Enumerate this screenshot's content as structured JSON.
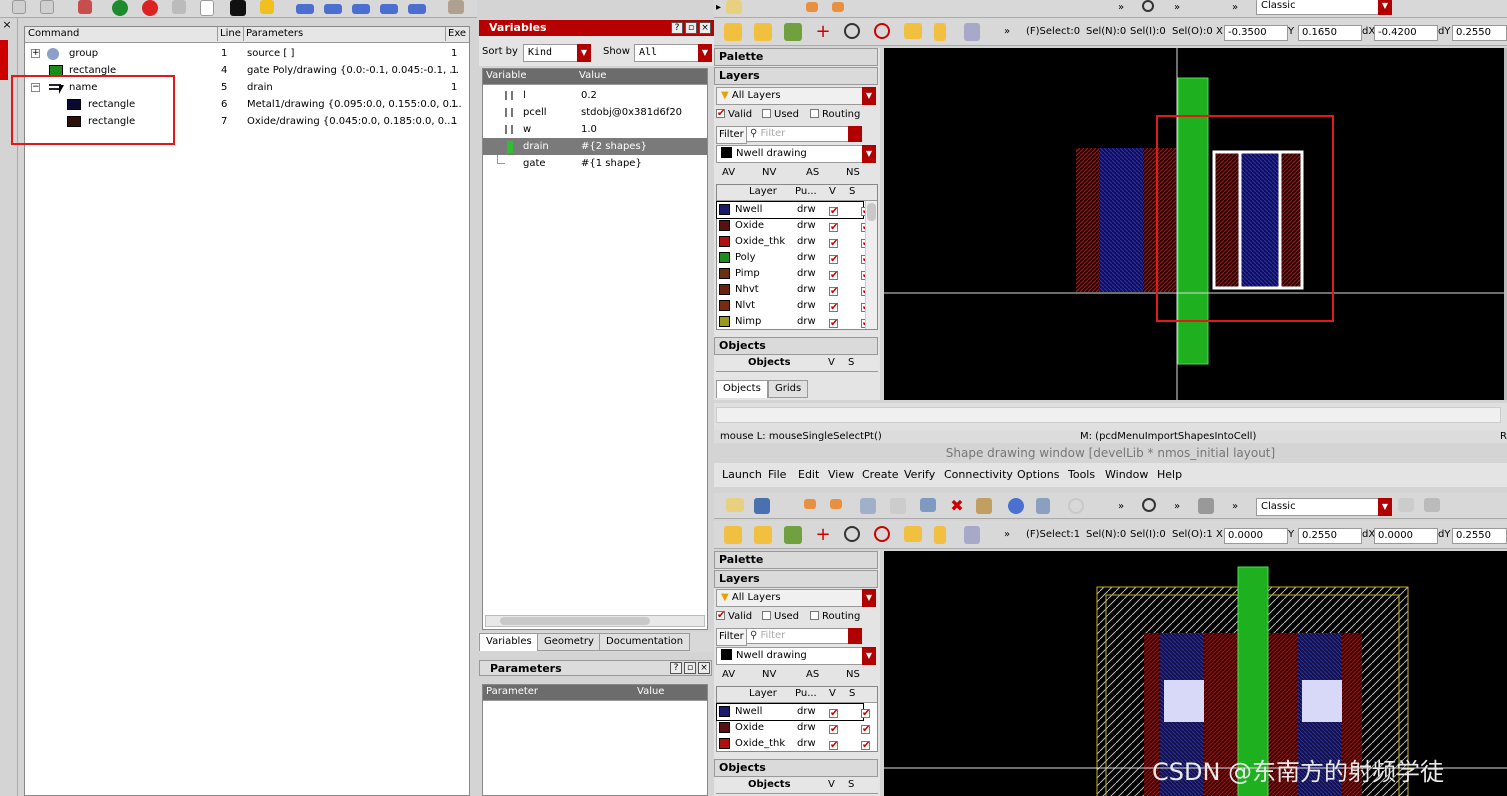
{
  "command_panel": {
    "headers": [
      "Command",
      "Line",
      "Parameters",
      "Exe"
    ],
    "rows": [
      {
        "cmd": "group",
        "line": "1",
        "params": "source [ ]",
        "exe": "1"
      },
      {
        "cmd": "rectangle",
        "line": "4",
        "params": "gate Poly/drawing {0.0:-0.1, 0.045:-0.1, ...",
        "exe": "1"
      },
      {
        "cmd": "name",
        "line": "5",
        "params": "drain",
        "exe": "1"
      },
      {
        "cmd": "rectangle",
        "line": "6",
        "params": "Metal1/drawing {0.095:0.0, 0.155:0.0, 0....",
        "exe": "1"
      },
      {
        "cmd": "rectangle",
        "line": "7",
        "params": "Oxide/drawing {0.045:0.0, 0.185:0.0, 0....",
        "exe": "1"
      }
    ]
  },
  "variables_panel": {
    "title": "Variables",
    "sort_label": "Sort by",
    "sort_value": "Kind",
    "show_label": "Show",
    "show_value": "All",
    "headers": [
      "Variable",
      "Value"
    ],
    "rows": [
      {
        "name": "l",
        "value": "0.2"
      },
      {
        "name": "pcell",
        "value": "stdobj@0x381d6f20"
      },
      {
        "name": "w",
        "value": "1.0"
      },
      {
        "name": "drain",
        "value": "#{2 shapes}"
      },
      {
        "name": "gate",
        "value": "#{1 shape}"
      }
    ],
    "tabs": [
      "Variables",
      "Geometry",
      "Documentation"
    ]
  },
  "parameters_panel": {
    "title": "Parameters",
    "headers": [
      "Parameter",
      "Value"
    ]
  },
  "top_layout": {
    "style_value": "Classic",
    "coords": {
      "select": "(F)Select:0",
      "seln": "Sel(N):0",
      "seli": "Sel(I):0",
      "selo": "Sel(O):0",
      "x_label": "X",
      "x": "-0.3500",
      "y_label": "Y",
      "y": "0.1650",
      "dx_label": "dX",
      "dx": "-0.4200",
      "dy_label": "dY",
      "dy": "0.2550"
    },
    "palette": "Palette",
    "layers": "Layers",
    "all_layers": "All Layers",
    "valid": "Valid",
    "used": "Used",
    "routing": "Routing",
    "filter": "Filter",
    "filter_placeholder": "Filter",
    "current_layer": "Nwell drawing",
    "vis": [
      "AV",
      "NV",
      "AS",
      "NS"
    ],
    "layer_headers": [
      "Layer",
      "Pu...",
      "V",
      "S"
    ],
    "layer_rows": [
      {
        "name": "Nwell",
        "purpose": "drw",
        "color": "#1a1a6e"
      },
      {
        "name": "Oxide",
        "purpose": "drw",
        "color": "#5a1010"
      },
      {
        "name": "Oxide_thk",
        "purpose": "drw",
        "color": "#b01010"
      },
      {
        "name": "Poly",
        "purpose": "drw",
        "color": "#1c8c1c"
      },
      {
        "name": "Pimp",
        "purpose": "drw",
        "color": "#6a3010"
      },
      {
        "name": "Nhvt",
        "purpose": "drw",
        "color": "#6a2010"
      },
      {
        "name": "Nlvt",
        "purpose": "drw",
        "color": "#7a2a10"
      },
      {
        "name": "Nimp",
        "purpose": "drw",
        "color": "#9a9a20"
      }
    ],
    "objects": "Objects",
    "objects_headers": [
      "Objects",
      "V",
      "S"
    ],
    "bottom_tabs": [
      "Objects",
      "Grids"
    ]
  },
  "status": {
    "mouse": "mouse L: mouseSingleSelectPt()",
    "menu": "M: (pcdMenuImportShapesIntoCell)",
    "right": "R"
  },
  "bottom_layout": {
    "window_title": "Shape drawing window [develLib * nmos_initial layout]",
    "menu": [
      "Launch",
      "File",
      "Edit",
      "View",
      "Create",
      "Verify",
      "Connectivity",
      "Options",
      "Tools",
      "Window",
      "Help"
    ],
    "style_value": "Classic",
    "coords": {
      "select": "(F)Select:1",
      "seln": "Sel(N):0",
      "seli": "Sel(I):0",
      "selo": "Sel(O):1",
      "x_label": "X",
      "x": "0.0000",
      "y_label": "Y",
      "y": "0.2550",
      "dx_label": "dX",
      "dx": "0.0000",
      "dy_label": "dY",
      "dy": "0.2550"
    },
    "palette": "Palette",
    "layers": "Layers",
    "all_layers": "All Layers",
    "valid": "Valid",
    "used": "Used",
    "routing": "Routing",
    "filter": "Filter",
    "filter_placeholder": "Filter",
    "current_layer": "Nwell drawing",
    "vis": [
      "AV",
      "NV",
      "AS",
      "NS"
    ],
    "layer_headers": [
      "Layer",
      "Pu...",
      "V",
      "S"
    ],
    "layer_rows": [
      {
        "name": "Nwell",
        "purpose": "drw",
        "color": "#1a1a6e"
      },
      {
        "name": "Oxide",
        "purpose": "drw",
        "color": "#5a1010"
      },
      {
        "name": "Oxide_thk",
        "purpose": "drw",
        "color": "#b01010"
      }
    ],
    "objects": "Objects",
    "objects_headers": [
      "Objects",
      "V",
      "S"
    ]
  },
  "watermark": "CSDN @东南方的射频学徒"
}
